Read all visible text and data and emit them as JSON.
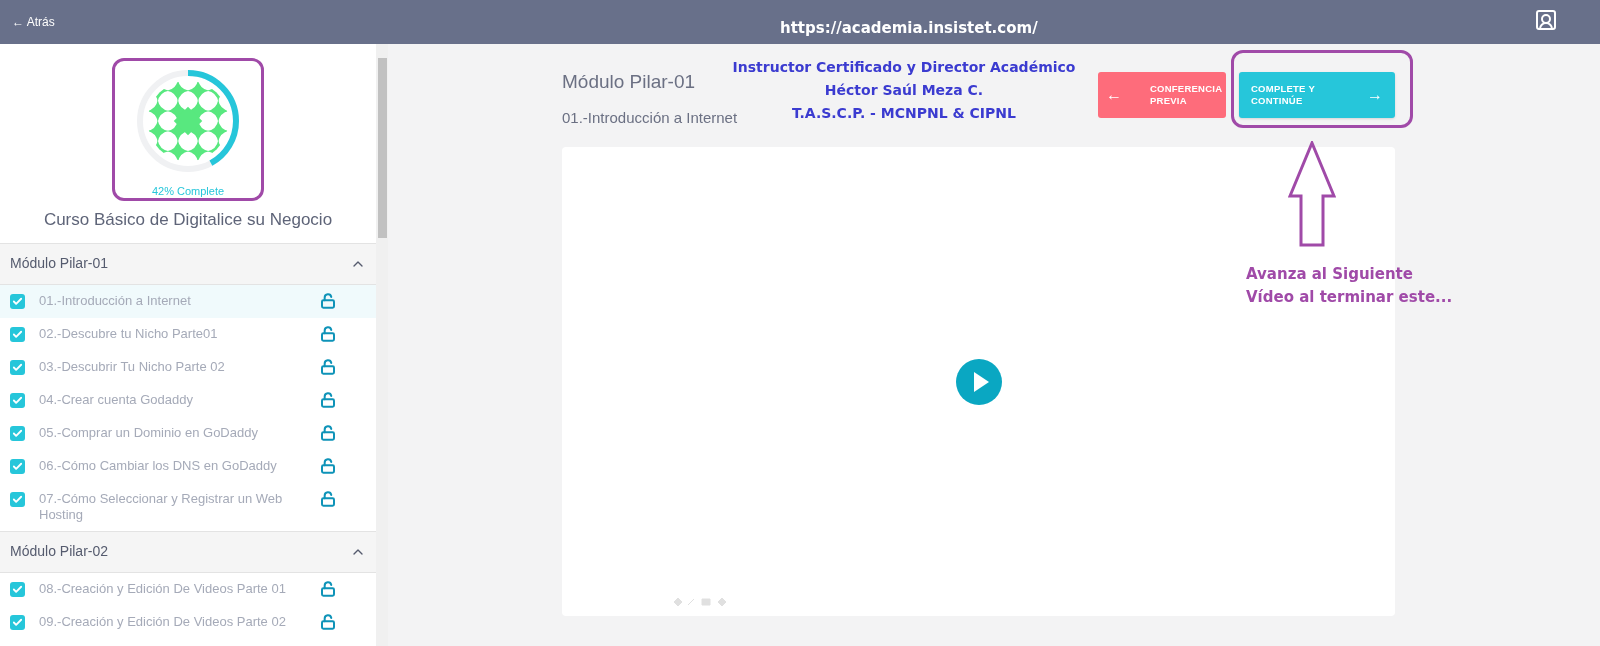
{
  "top_bar": {
    "back": "← Atrás",
    "url": "https://academia.insistet.com/"
  },
  "course": {
    "progress": {
      "level": 0.42,
      "label": "42% Complete"
    },
    "title": "Curso Básico de Digitalice su Negocio"
  },
  "modules": [
    {
      "title": "Módulo Pilar-01",
      "expanded": true,
      "lessons": [
        {
          "title": "01.-Introducción a Internet",
          "checked": true,
          "selected": true
        },
        {
          "title": "02.-Descubre tu Nicho Parte01",
          "checked": true,
          "selected": false
        },
        {
          "title": "03.-Descubrir Tu Nicho Parte 02",
          "checked": true,
          "selected": false
        },
        {
          "title": "04.-Crear cuenta Godaddy",
          "checked": true,
          "selected": false
        },
        {
          "title": "05.-Comprar un Dominio en GoDaddy",
          "checked": true,
          "selected": false
        },
        {
          "title": "06.-Cómo Cambiar los DNS en GoDaddy",
          "checked": true,
          "selected": false
        },
        {
          "title": "07.-Cómo Seleccionar y Registrar un Web Hosting",
          "checked": true,
          "selected": false
        }
      ]
    },
    {
      "title": "Módulo Pilar-02",
      "expanded": true,
      "lessons": [
        {
          "title": "08.-Creación y Edición De Videos Parte 01",
          "checked": true,
          "selected": false
        },
        {
          "title": "09.-Creación y Edición De Videos Parte 02",
          "checked": true,
          "selected": false
        }
      ]
    }
  ],
  "lesson_header": {
    "module": "Módulo Pilar-01",
    "lesson": "01.-Introducción a Internet"
  },
  "instructor": [
    "Instructor Certificado y Director Académico",
    "Héctor Saúl Meza C.",
    "T.A.S.C.P. - MCNPNL & CIPNL"
  ],
  "buttons": {
    "previous": {
      "arrow": "←",
      "label": "CONFERENCIA PREVIA"
    },
    "next": {
      "label": "COMPLETE Y CONTINÚE",
      "arrow": "→"
    }
  },
  "annotation": {
    "text": "Avanza al Siguiente Vídeo al terminar este..."
  }
}
